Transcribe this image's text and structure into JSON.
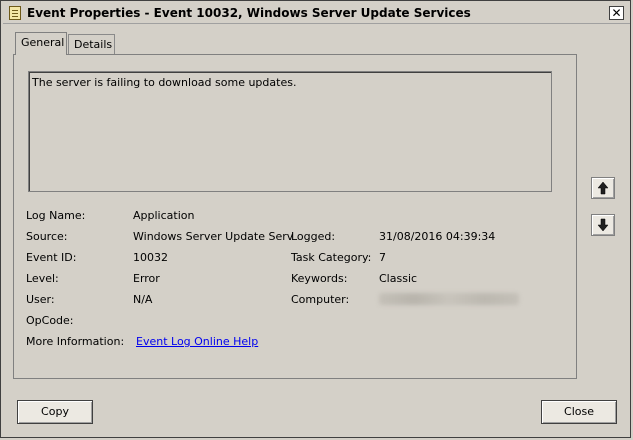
{
  "window": {
    "title": "Event Properties - Event 10032, Windows Server Update Services",
    "close_glyph": "✕"
  },
  "tabs": [
    {
      "label": "General",
      "active": true
    },
    {
      "label": "Details",
      "active": false
    }
  ],
  "description": "The server is failing to download some updates.",
  "fields": {
    "log_name": {
      "label": "Log Name:",
      "value": "Application"
    },
    "source": {
      "label": "Source:",
      "value": "Windows Server Update Serv"
    },
    "logged": {
      "label": "Logged:",
      "value": "31/08/2016 04:39:34"
    },
    "event_id": {
      "label": "Event ID:",
      "value": "10032"
    },
    "task_category": {
      "label": "Task Category:",
      "value": "7"
    },
    "level": {
      "label": "Level:",
      "value": "Error"
    },
    "keywords": {
      "label": "Keywords:",
      "value": "Classic"
    },
    "user": {
      "label": "User:",
      "value": "N/A"
    },
    "computer": {
      "label": "Computer:",
      "value": ""
    },
    "opcode": {
      "label": "OpCode:",
      "value": ""
    },
    "more_info": {
      "label": "More Information:",
      "link": "Event Log Online Help"
    }
  },
  "buttons": {
    "copy": "Copy",
    "close": "Close"
  }
}
